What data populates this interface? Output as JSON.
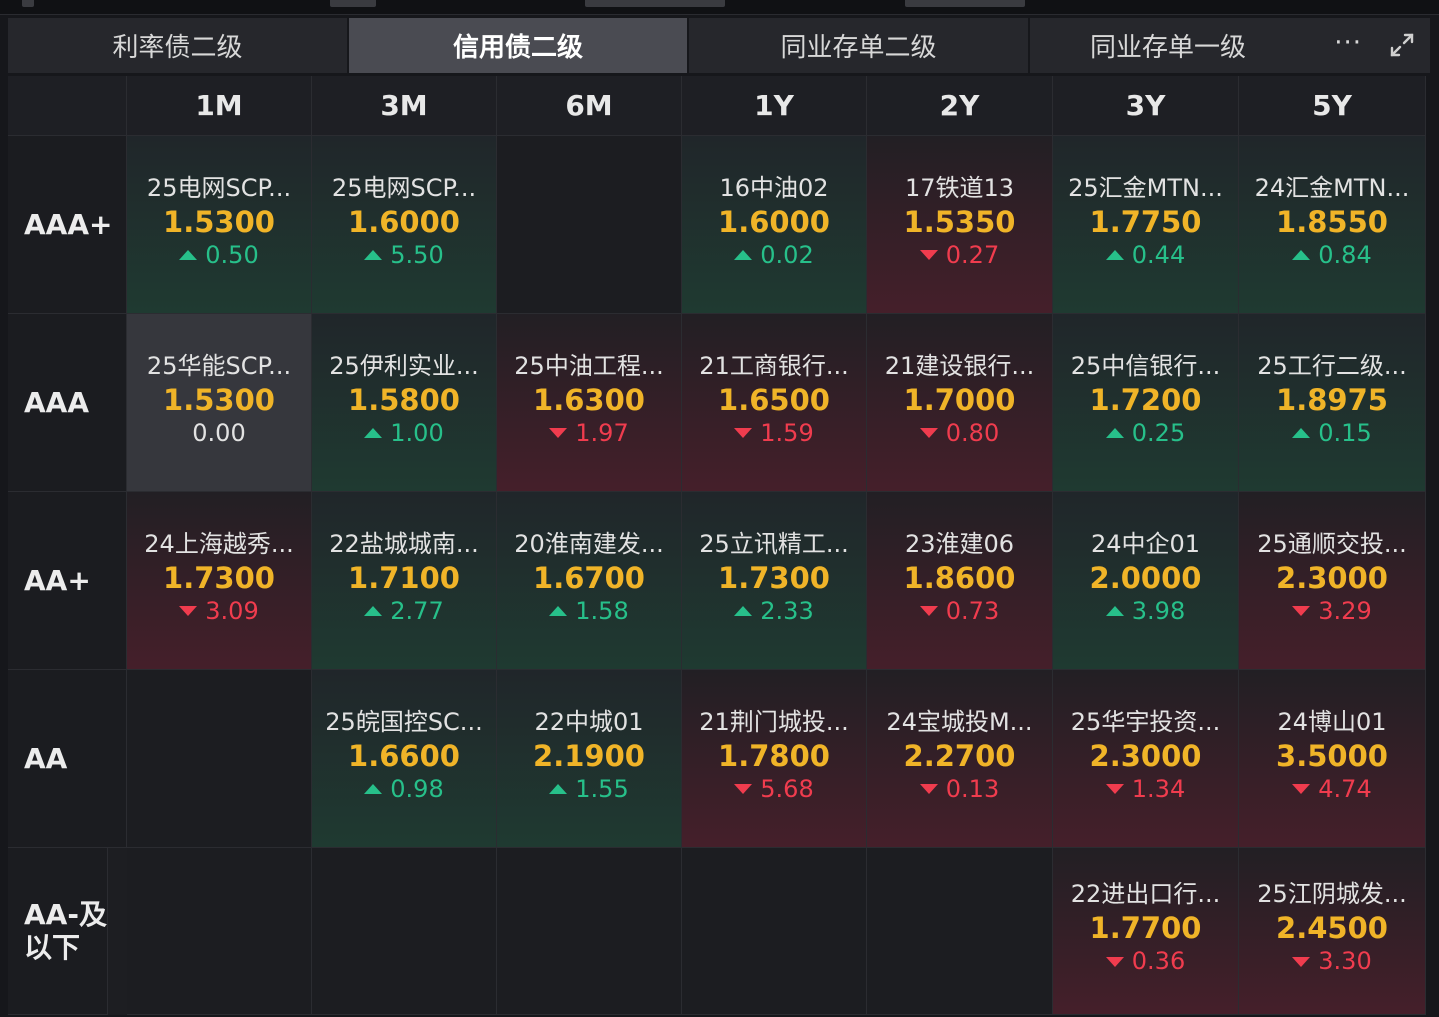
{
  "tabs": [
    {
      "label": "利率债二级",
      "active": false
    },
    {
      "label": "信用债二级",
      "active": true
    },
    {
      "label": "同业存单二级",
      "active": false
    },
    {
      "label": "同业存单一级",
      "active": false
    }
  ],
  "more_label": "···",
  "colors": {
    "yield": "#f0b428",
    "up": "#27c08a",
    "down": "#f03c4e",
    "active_tab": "#4a4b52"
  },
  "tenors": [
    "1M",
    "3M",
    "6M",
    "1Y",
    "2Y",
    "3Y",
    "5Y"
  ],
  "ratings": [
    "AAA+",
    "AAA",
    "AA+",
    "AA",
    "AA-及以下"
  ],
  "matrix": [
    [
      {
        "bond": "25电网SCP...",
        "yield": "1.5300",
        "change": "0.50",
        "dir": "up"
      },
      {
        "bond": "25电网SCP...",
        "yield": "1.6000",
        "change": "5.50",
        "dir": "up"
      },
      null,
      {
        "bond": "16中油02",
        "yield": "1.6000",
        "change": "0.02",
        "dir": "up"
      },
      {
        "bond": "17铁道13",
        "yield": "1.5350",
        "change": "0.27",
        "dir": "down"
      },
      {
        "bond": "25汇金MTN...",
        "yield": "1.7750",
        "change": "0.44",
        "dir": "up"
      },
      {
        "bond": "24汇金MTN...",
        "yield": "1.8550",
        "change": "0.84",
        "dir": "up"
      }
    ],
    [
      {
        "bond": "25华能SCP...",
        "yield": "1.5300",
        "change": "0.00",
        "dir": "flat"
      },
      {
        "bond": "25伊利实业...",
        "yield": "1.5800",
        "change": "1.00",
        "dir": "up"
      },
      {
        "bond": "25中油工程...",
        "yield": "1.6300",
        "change": "1.97",
        "dir": "down"
      },
      {
        "bond": "21工商银行...",
        "yield": "1.6500",
        "change": "1.59",
        "dir": "down"
      },
      {
        "bond": "21建设银行...",
        "yield": "1.7000",
        "change": "0.80",
        "dir": "down"
      },
      {
        "bond": "25中信银行...",
        "yield": "1.7200",
        "change": "0.25",
        "dir": "up"
      },
      {
        "bond": "25工行二级...",
        "yield": "1.8975",
        "change": "0.15",
        "dir": "up"
      }
    ],
    [
      {
        "bond": "24上海越秀...",
        "yield": "1.7300",
        "change": "3.09",
        "dir": "down"
      },
      {
        "bond": "22盐城城南...",
        "yield": "1.7100",
        "change": "2.77",
        "dir": "up"
      },
      {
        "bond": "20淮南建发...",
        "yield": "1.6700",
        "change": "1.58",
        "dir": "up"
      },
      {
        "bond": "25立讯精工...",
        "yield": "1.7300",
        "change": "2.33",
        "dir": "up"
      },
      {
        "bond": "23淮建06",
        "yield": "1.8600",
        "change": "0.73",
        "dir": "down"
      },
      {
        "bond": "24中企01",
        "yield": "2.0000",
        "change": "3.98",
        "dir": "up"
      },
      {
        "bond": "25通顺交投...",
        "yield": "2.3000",
        "change": "3.29",
        "dir": "down"
      }
    ],
    [
      null,
      {
        "bond": "25皖国控SC...",
        "yield": "1.6600",
        "change": "0.98",
        "dir": "up"
      },
      {
        "bond": "22中城01",
        "yield": "2.1900",
        "change": "1.55",
        "dir": "up"
      },
      {
        "bond": "21荆门城投...",
        "yield": "1.7800",
        "change": "5.68",
        "dir": "down"
      },
      {
        "bond": "24宝城投M...",
        "yield": "2.2700",
        "change": "0.13",
        "dir": "down"
      },
      {
        "bond": "25华宇投资...",
        "yield": "2.3000",
        "change": "1.34",
        "dir": "down"
      },
      {
        "bond": "24博山01",
        "yield": "3.5000",
        "change": "4.74",
        "dir": "down"
      }
    ],
    [
      null,
      null,
      null,
      null,
      null,
      {
        "bond": "22进出口行...",
        "yield": "1.7700",
        "change": "0.36",
        "dir": "down"
      },
      {
        "bond": "25江阴城发...",
        "yield": "2.4500",
        "change": "3.30",
        "dir": "down"
      }
    ]
  ]
}
